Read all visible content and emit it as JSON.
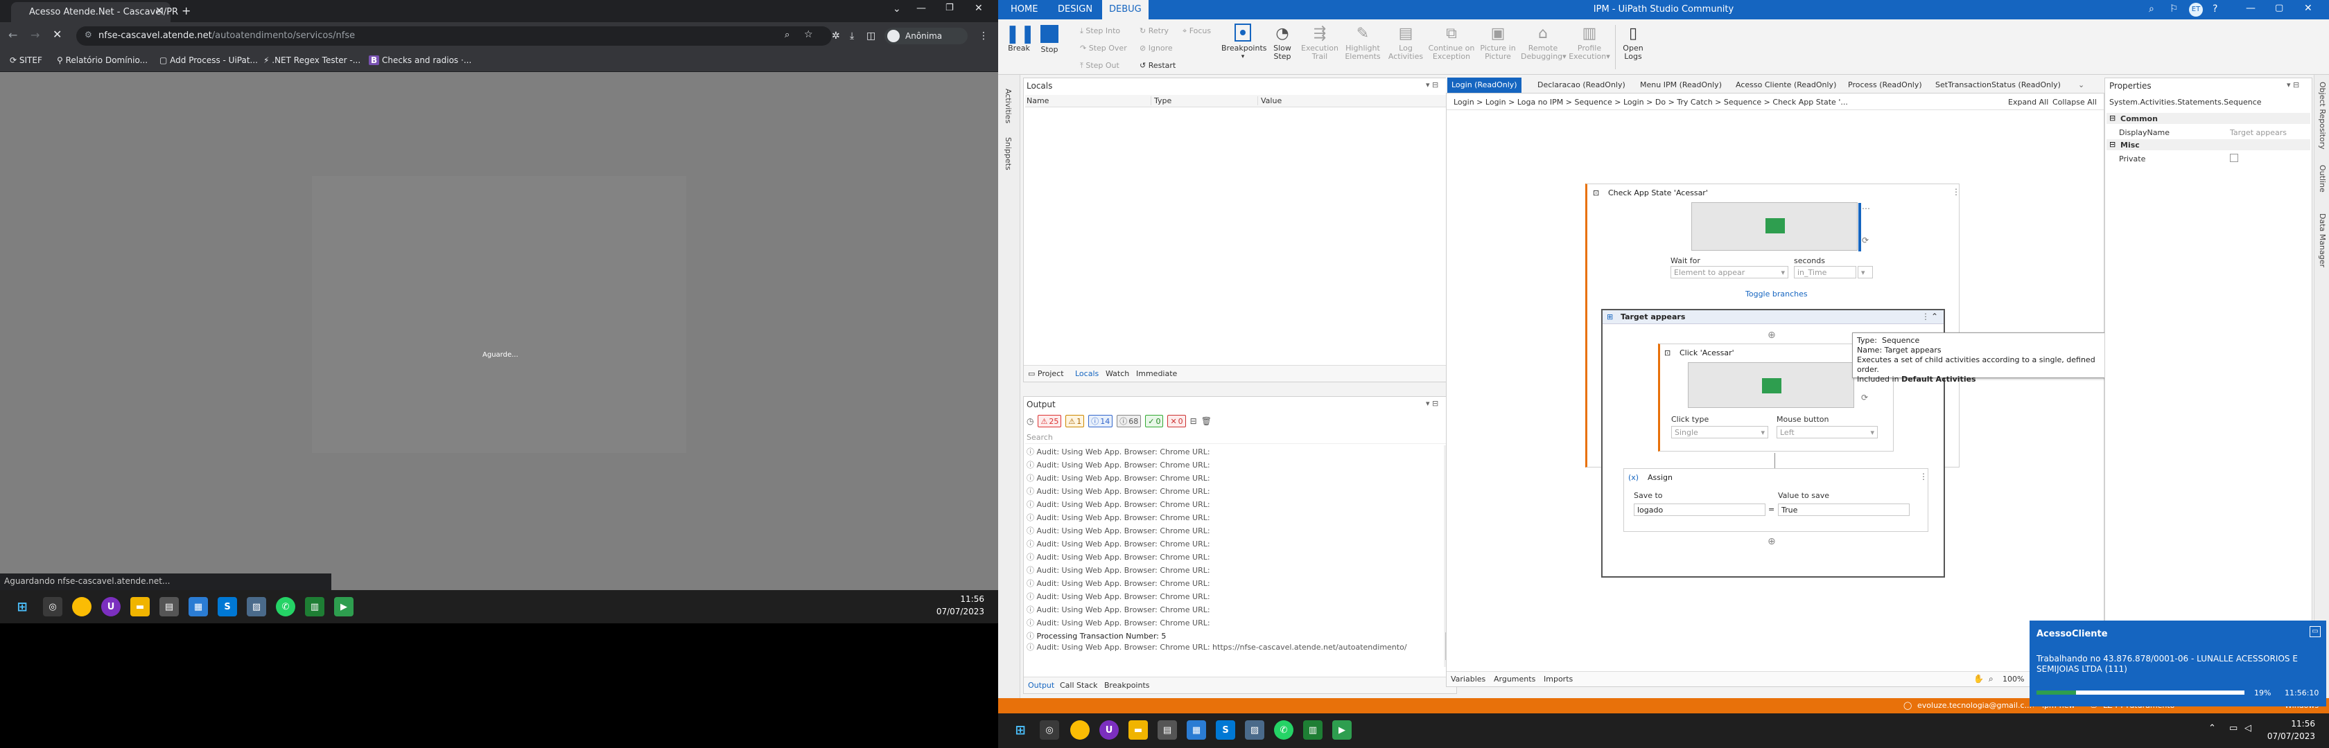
{
  "browser": {
    "tab_title": "Acesso Atende.Net - Cascavel/PR",
    "url_host": "nfse-cascavel.atende.net",
    "url_path": "/autoatendimento/servicos/nfse",
    "profile": "Anônima",
    "bookmarks": [
      "SITEF",
      "Relatório Domínio...",
      "Add Process - UiPat...",
      ".NET Regex Tester -...",
      "Checks and radios ·..."
    ],
    "page_message": "Aguarde...",
    "status_url": "Aguardando nfse-cascavel.atende.net...",
    "clock_time": "11:56",
    "clock_date": "07/07/2023"
  },
  "studio": {
    "window_title": "IPM - UiPath Studio Community",
    "ribbon_tabs": [
      "HOME",
      "DESIGN",
      "DEBUG"
    ],
    "ribbon": {
      "break": "Break",
      "stop": "Stop",
      "step_into": "Step Into",
      "step_over": "Step Over",
      "step_out": "Step Out",
      "retry": "Retry",
      "ignore": "Ignore",
      "restart": "Restart",
      "focus": "Focus",
      "breakpoints": "Breakpoints",
      "slow_step_1": "Slow",
      "slow_step_2": "Step",
      "exec_trail_1": "Execution",
      "exec_trail_2": "Trail",
      "highlight_1": "Highlight",
      "highlight_2": "Elements",
      "log_act_1": "Log",
      "log_act_2": "Activities",
      "continue_1": "Continue on",
      "continue_2": "Exception",
      "picture_1": "Picture in",
      "picture_2": "Picture",
      "remote_1": "Remote",
      "remote_2": "Debugging",
      "profile_1": "Profile",
      "profile_2": "Execution",
      "open_logs_1": "Open",
      "open_logs_2": "Logs"
    },
    "side_left": [
      "Activities",
      "Snippets"
    ],
    "side_right": [
      "Object Repository",
      "Outline",
      "Data Manager"
    ],
    "locals": {
      "title": "Locals",
      "cols": [
        "Name",
        "Type",
        "Value"
      ],
      "bottom_tabs": [
        "Project",
        "Locals",
        "Watch",
        "Immediate"
      ]
    },
    "output": {
      "title": "Output",
      "counts": {
        "err": "25",
        "warn": "1",
        "info": "14",
        "trace": "68",
        "verb": "0",
        "fatal": "0"
      },
      "search": "Search",
      "lines": [
        "Audit: Using Web App. Browser: Chrome URL:",
        "Audit: Using Web App. Browser: Chrome URL:",
        "Audit: Using Web App. Browser: Chrome URL:",
        "Audit: Using Web App. Browser: Chrome URL:",
        "Audit: Using Web App. Browser: Chrome URL:",
        "Audit: Using Web App. Browser: Chrome URL:",
        "Audit: Using Web App. Browser: Chrome URL:",
        "Audit: Using Web App. Browser: Chrome URL:",
        "Audit: Using Web App. Browser: Chrome URL:",
        "Audit: Using Web App. Browser: Chrome URL:",
        "Audit: Using Web App. Browser: Chrome URL:",
        "Audit: Using Web App. Browser: Chrome URL:",
        "Audit: Using Web App. Browser: Chrome URL:",
        "Audit: Using Web App. Browser: Chrome URL:"
      ],
      "processing": "Processing Transaction Number: 5",
      "last_line_1": "Audit: Using Web App. Browser: Chrome URL: https://nfse-cascavel.atende.net/autoatendimento/",
      "last_line_2": "servicos/nfse",
      "bottom_tabs": [
        "Output",
        "Call Stack",
        "Breakpoints"
      ]
    },
    "doc_tabs": [
      "Login (ReadOnly)",
      "Declaracao (ReadOnly)",
      "Menu IPM (ReadOnly)",
      "Acesso Cliente (ReadOnly)",
      "Process (ReadOnly)",
      "SetTransactionStatus (ReadOnly)"
    ],
    "breadcrumb": [
      "Login",
      "Login",
      "Loga no IPM",
      "Sequence",
      "Login",
      "Do",
      "Try Catch",
      "Sequence",
      "Check App State '..."
    ],
    "expand_all": "Expand All",
    "collapse_all": "Collapse All",
    "check_app_state": {
      "title": "Check App State 'Acessar'",
      "wait_for_label": "Wait for",
      "wait_for_value": "Element to appear",
      "seconds_label": "seconds",
      "seconds_value": "in_Time",
      "toggle": "Toggle branches"
    },
    "target_appears": {
      "title": "Target appears",
      "click_title": "Click 'Acessar'",
      "click_type_label": "Click type",
      "click_type_value": "Single",
      "mouse_button_label": "Mouse button",
      "mouse_button_value": "Left",
      "assign_title": "Assign",
      "save_to_label": "Save to",
      "save_to_value": "logado",
      "value_label": "Value to save",
      "value_value": "True",
      "eq": "="
    },
    "tooltip": {
      "type_label": "Type:",
      "type_value": "Sequence",
      "name_label": "Name:",
      "name_value": "Target appears",
      "desc": "Executes a set of child activities according to a single, defined order.",
      "included": "Included in",
      "included_bold": "Default Activities"
    },
    "designer_bottom": [
      "Variables",
      "Arguments",
      "Imports"
    ],
    "zoom": "100%",
    "properties": {
      "title": "Properties",
      "type": "System.Activities.Statements.Sequence",
      "common": "Common",
      "display_name_label": "DisplayName",
      "display_name_value": "Target appears",
      "misc": "Misc",
      "private_label": "Private"
    },
    "statusbar": {
      "user": "evoluze.tecnologia@gmail.c...",
      "branch": "ipm-new",
      "repo": "LZ-FT-Faturamento",
      "mode": "Windows"
    },
    "toast": {
      "title": "AcessoCliente",
      "message": "Trabalhando no 43.876.878/0001-06 - LUNALLE ACESSORIOS E SEMIJOIAS LTDA (111)",
      "progress_label": "19%",
      "progress": 0.19,
      "time": "11:56:10"
    },
    "clock_time": "11:56",
    "clock_date": "07/07/2023"
  }
}
